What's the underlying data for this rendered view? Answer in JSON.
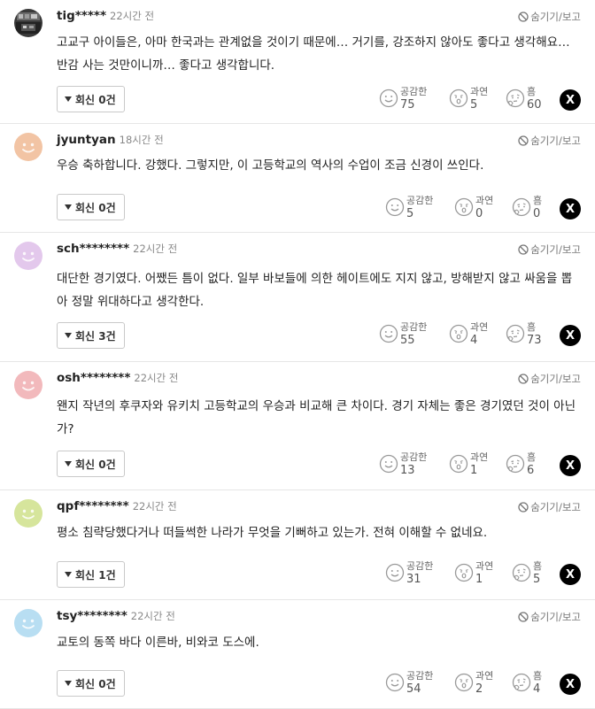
{
  "hide_label": "숨기기/보고",
  "react_labels": {
    "empathy": "공감한",
    "indeed": "과연",
    "hmm": "흠"
  },
  "x_label": "X",
  "comments": [
    {
      "user": "tig*****",
      "time": "22시간 전",
      "body": "고교구 아이들은, 아마 한국과는 관계없을 것이기 때문에… 거기를, 강조하지 않아도 좋다고 생각해요… 반감 사는 것만이니까… 좋다고 생각합니다.",
      "reply": "회신 0건",
      "empathy": "75",
      "indeed": "5",
      "hmm": "60",
      "avatar": "photo"
    },
    {
      "user": "jyuntyan",
      "time": "18시간 전",
      "body": "우승 축하합니다. 강했다. 그렇지만, 이 고등학교의 역사의 수업이 조금 신경이 쓰인다.",
      "reply": "회신 0건",
      "empathy": "5",
      "indeed": "0",
      "hmm": "0",
      "avatar": "#f2c4a4"
    },
    {
      "user": "sch********",
      "time": "22시간 전",
      "body": "대단한 경기였다. 어쨌든 틈이 없다. 일부 바보들에 의한 헤이트에도 지지 않고, 방해받지 않고 싸움을 뽑아 정말 위대하다고 생각한다.",
      "reply": "회신 3건",
      "empathy": "55",
      "indeed": "4",
      "hmm": "73",
      "avatar": "#e3c8ec"
    },
    {
      "user": "osh********",
      "time": "22시간 전",
      "body": "왠지 작년의 후쿠자와 유키치 고등학교의 우승과 비교해 큰 차이다. 경기 자체는 좋은 경기였던 것이 아닌가?",
      "reply": "회신 0건",
      "empathy": "13",
      "indeed": "1",
      "hmm": "6",
      "avatar": "#f2b9bc"
    },
    {
      "user": "qpf********",
      "time": "22시간 전",
      "body": "평소 침략당했다거나 떠들썩한 나라가 무엇을 기뻐하고 있는가. 전혀 이해할 수 없네요.",
      "reply": "회신 1건",
      "empathy": "31",
      "indeed": "1",
      "hmm": "5",
      "avatar": "#d6e59c"
    },
    {
      "user": "tsy********",
      "time": "22시간 전",
      "body": "교토의 동쪽 바다 이른바, 비와코 도스에.",
      "reply": "회신 0건",
      "empathy": "54",
      "indeed": "2",
      "hmm": "4",
      "avatar": "#b8def2"
    }
  ]
}
